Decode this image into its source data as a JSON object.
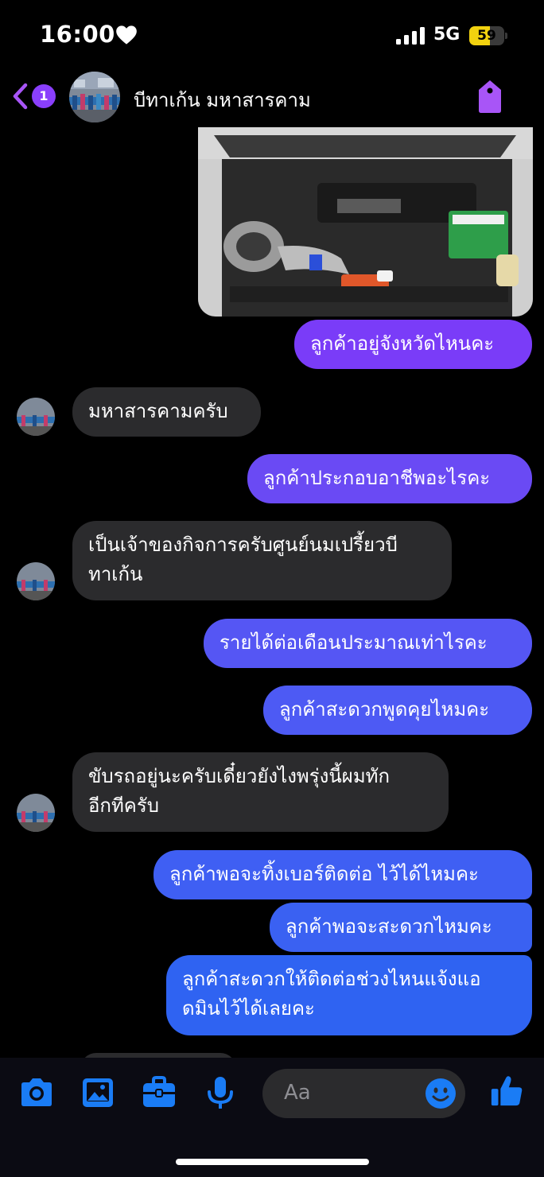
{
  "status_bar": {
    "time": "16:00",
    "network": "5G",
    "battery": "59",
    "battery_level": 0.59
  },
  "header": {
    "back_badge": "1",
    "contact_name": "บีทาเก้น มหาสารคาม"
  },
  "messages": [
    {
      "direction": "outgoing",
      "text": "ลูกค้าอยู่จังหวัดไหนคะ"
    },
    {
      "direction": "incoming",
      "text": "มหาสารคามครับ"
    },
    {
      "direction": "outgoing",
      "text": "ลูกค้าประกอบอาชีพอะไรคะ"
    },
    {
      "direction": "incoming",
      "lines": [
        "เป็นเจ้าของกิจการครับศูนย์นมเปรี้ยวบี",
        "ทาเก้น"
      ]
    },
    {
      "direction": "outgoing",
      "text": "รายได้ต่อเดือนประมาณเท่าไรคะ"
    },
    {
      "direction": "outgoing",
      "text": "ลูกค้าสะดวกพูดคุยไหมคะ"
    },
    {
      "direction": "incoming",
      "lines": [
        "ขับรถอยู่นะครับเดี๋ยวยังไงพรุ่งนี้ผมทัก",
        "อีกทีครับ"
      ]
    },
    {
      "direction": "outgoing",
      "text": "ลูกค้าพอจะทิ้งเบอร์ติดต่อ ไว้ได้ไหมคะ"
    },
    {
      "direction": "outgoing",
      "text": "ลูกค้าพอจะสะดวกไหมคะ"
    },
    {
      "direction": "outgoing",
      "lines": [
        "ลูกค้าสะดวกให้ติดต่อช่วงไหนแจ้งแอ",
        "ดมินไว้ได้เลยคะ"
      ]
    }
  ],
  "composer": {
    "placeholder": "Aa"
  },
  "icons": [
    "heart-icon",
    "signal-icon",
    "battery-icon",
    "back-chevron-icon",
    "tag-icon",
    "camera-icon",
    "gallery-icon",
    "toolbox-icon",
    "microphone-icon",
    "emoji-icon",
    "thumbs-up-icon"
  ],
  "colors": {
    "outgoing_top": "#7a3cf8",
    "outgoing_bottom": "#2f63f2",
    "incoming": "#2b2b2d",
    "accent": "#a855f7",
    "composer_icons": "#1a7cf5"
  }
}
